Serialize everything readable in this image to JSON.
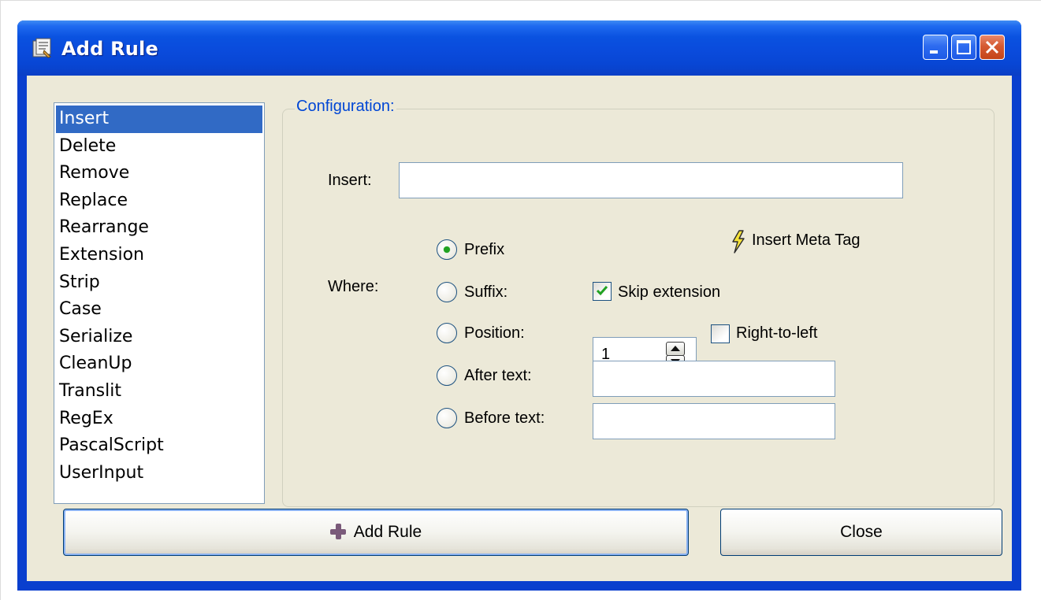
{
  "window": {
    "title": "Add Rule",
    "buttons": [
      "minimize",
      "maximize",
      "close"
    ]
  },
  "rule_list": {
    "selected": "Insert",
    "items": [
      "Insert",
      "Delete",
      "Remove",
      "Replace",
      "Rearrange",
      "Extension",
      "Strip",
      "Case",
      "Serialize",
      "CleanUp",
      "Translit",
      "RegEx",
      "PascalScript",
      "UserInput"
    ]
  },
  "configuration": {
    "legend": "Configuration:",
    "insert_label": "Insert:",
    "insert_value": "",
    "meta_tag_label": "Insert Meta Tag",
    "where_label": "Where:",
    "options": {
      "prefix": "Prefix",
      "suffix": "Suffix:",
      "position": "Position:",
      "after_text": "After text:",
      "before_text": "Before text:"
    },
    "selected_option": "prefix",
    "skip_extension_label": "Skip extension",
    "skip_extension_checked": true,
    "position_value": "1",
    "right_to_left_label": "Right-to-left",
    "right_to_left_checked": false,
    "after_text_value": "",
    "before_text_value": ""
  },
  "footer": {
    "add_rule_label": "Add Rule",
    "close_label": "Close"
  },
  "colors": {
    "title_bar": "#0a52e0",
    "selection": "#316ac5",
    "legend_text": "#0046d5",
    "dialog_bg": "#ece9d8"
  },
  "icons": {
    "title": "rule-app-icon",
    "meta_tag": "lightning-bolt-icon",
    "add_rule": "plus-icon"
  }
}
